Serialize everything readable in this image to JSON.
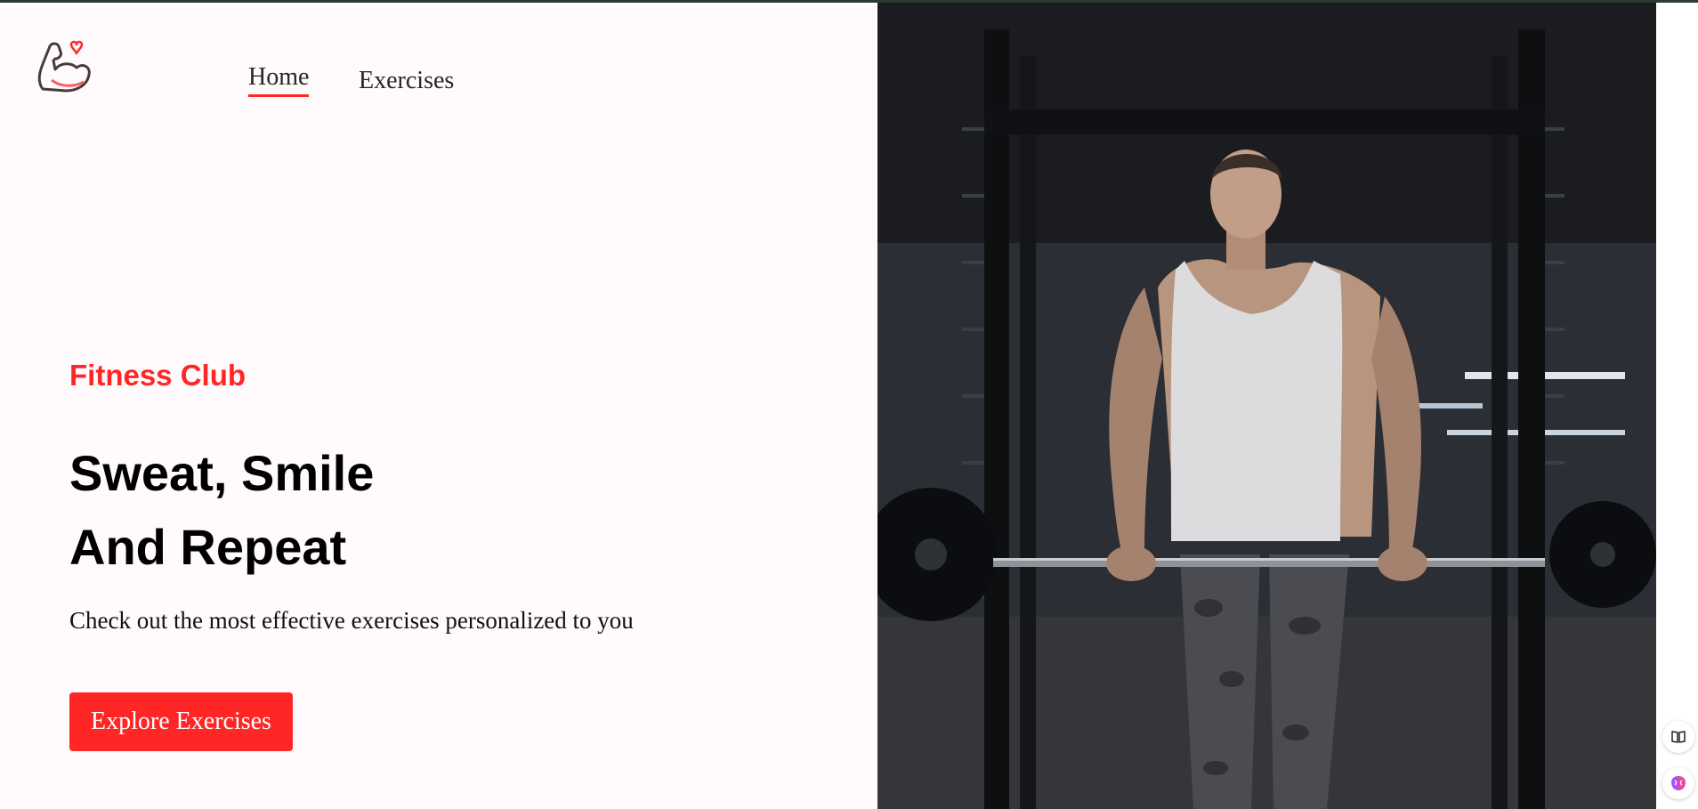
{
  "nav": {
    "logo_icon": "flexed-arm-heart-icon",
    "links": [
      {
        "label": "Home",
        "active": true
      },
      {
        "label": "Exercises",
        "active": false
      }
    ]
  },
  "hero": {
    "kicker": "Fitness Club",
    "title_line1": "Sweat, Smile",
    "title_line2": "And Repeat",
    "subtitle": "Check out the most effective exercises personalized to you",
    "cta_label": "Explore Exercises",
    "image_icon": "gym-barbell-photo"
  },
  "side_tools": [
    {
      "icon": "book-icon"
    },
    {
      "icon": "brain-icon"
    }
  ],
  "colors": {
    "accent": "#ff2625",
    "background": "#fffafb",
    "text": "#000000"
  }
}
